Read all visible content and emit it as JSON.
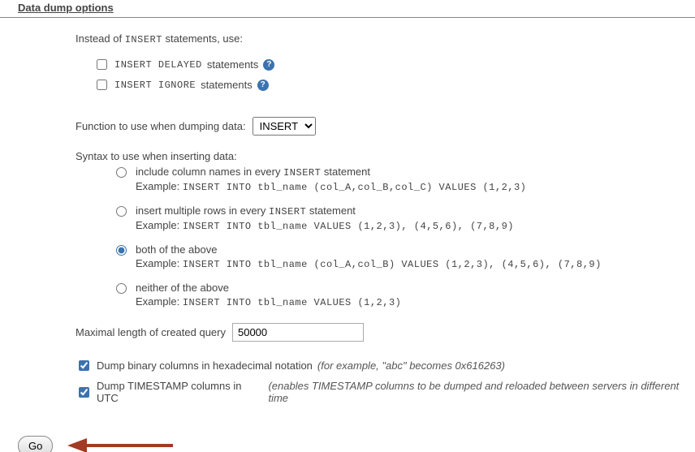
{
  "section_title": "Data dump options",
  "intro": {
    "prefix": "Instead of ",
    "code": "INSERT",
    "suffix": " statements, use:"
  },
  "opts": {
    "delayed": {
      "code": "INSERT DELAYED",
      "suffix": " statements",
      "checked": false
    },
    "ignore": {
      "code": "INSERT IGNORE",
      "suffix": " statements",
      "checked": false
    }
  },
  "function_row": {
    "label": "Function to use when dumping data:",
    "selected": "INSERT"
  },
  "syntax_label": "Syntax to use when inserting data:",
  "radios": [
    {
      "label_pre": "include column names in every ",
      "label_code": "INSERT",
      "label_post": " statement",
      "example_prefix": "Example: ",
      "example_code": "INSERT INTO tbl_name (col_A,col_B,col_C) VALUES (1,2,3)",
      "checked": false
    },
    {
      "label_pre": "insert multiple rows in every ",
      "label_code": "INSERT",
      "label_post": " statement",
      "example_prefix": "Example: ",
      "example_code": "INSERT INTO tbl_name VALUES (1,2,3), (4,5,6), (7,8,9)",
      "checked": false
    },
    {
      "label_pre": "both of the above",
      "label_code": "",
      "label_post": "",
      "example_prefix": "Example: ",
      "example_code": "INSERT INTO tbl_name (col_A,col_B) VALUES (1,2,3), (4,5,6), (7,8,9)",
      "checked": true
    },
    {
      "label_pre": "neither of the above",
      "label_code": "",
      "label_post": "",
      "example_prefix": "Example: ",
      "example_code": "INSERT INTO tbl_name VALUES (1,2,3)",
      "checked": false
    }
  ],
  "maxlen": {
    "label": "Maximal length of created query",
    "value": "50000"
  },
  "hex": {
    "label": "Dump binary columns in hexadecimal notation ",
    "note": "(for example, \"abc\" becomes 0x616263)",
    "checked": true
  },
  "utc": {
    "label": "Dump TIMESTAMP columns in UTC ",
    "note": "(enables TIMESTAMP columns to be dumped and reloaded between servers in different time",
    "checked": true
  },
  "go_label": "Go"
}
